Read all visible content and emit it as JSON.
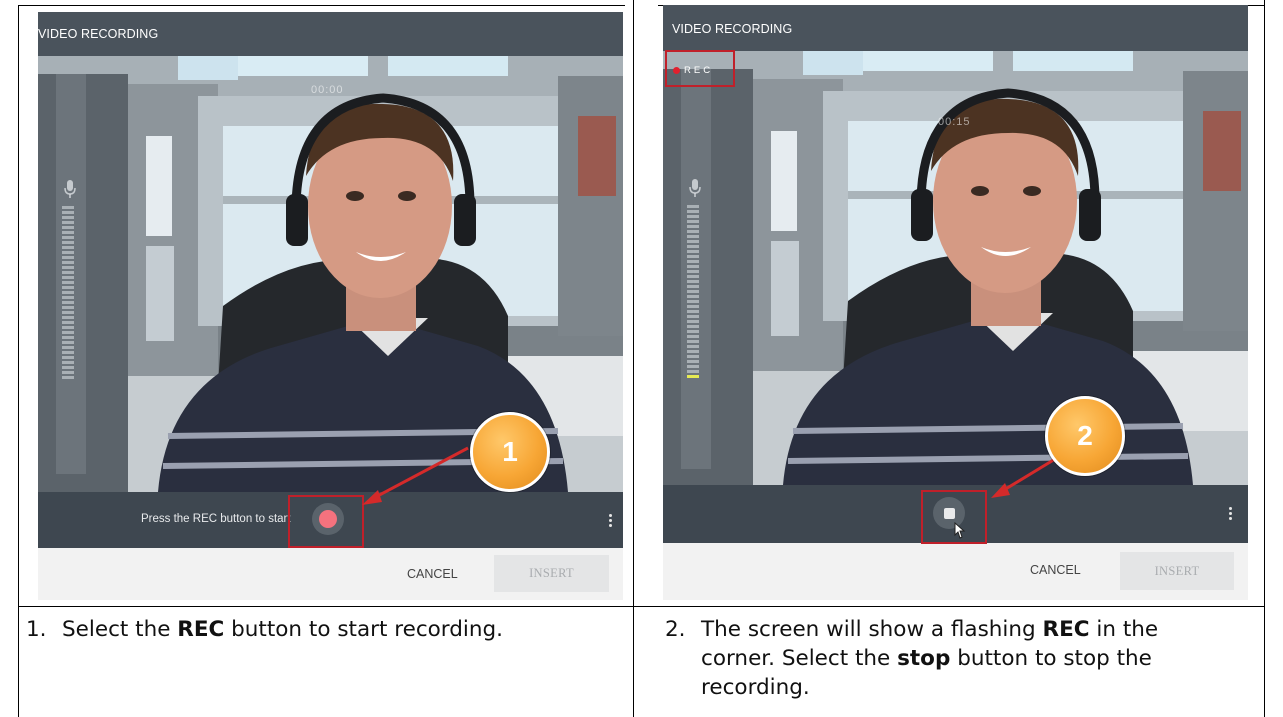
{
  "panel_left": {
    "title": "VIDEO RECORDING",
    "timer": "00:00",
    "prompt": "Press the REC button to start",
    "cancel_label": "CANCEL",
    "insert_label": "INSERT",
    "callout_number": "1",
    "rec_button_icon": "record-dot-icon",
    "more_icon": "more-vertical-icon",
    "mic_level": 0.0
  },
  "panel_right": {
    "title": "VIDEO RECORDING",
    "timer": "00:15",
    "rec_indicator": "REC",
    "cancel_label": "CANCEL",
    "insert_label": "INSERT",
    "callout_number": "2",
    "stop_button_icon": "stop-square-icon",
    "more_icon": "more-vertical-icon",
    "mic_level": 0.06
  },
  "instructions": {
    "step1": {
      "number": "1.",
      "before": "Select the ",
      "bold": "REC",
      "after": " button to start recording."
    },
    "step2": {
      "number": "2.",
      "line1_before": "The screen will show a flashing ",
      "line1_bold": "REC",
      "line1_after": " in the",
      "line2_before": "corner.  Select the ",
      "line2_bold": "stop",
      "line2_after": " button to stop the",
      "line3": "recording."
    }
  },
  "colors": {
    "titlebar": "#4a535c",
    "controlbar": "#3e4750",
    "highlight": "#c0202a",
    "callout": "#f7a635",
    "rec_dot": "#f5727e",
    "arrow": "#d42a2a"
  }
}
